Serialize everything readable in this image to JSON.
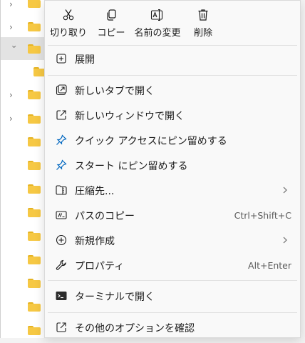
{
  "toolbar": {
    "cut_label": "切り取り",
    "copy_label": "コピー",
    "rename_label": "名前の変更",
    "delete_label": "削除"
  },
  "menu": {
    "expand": "展開",
    "open_new_tab": "新しいタブで開く",
    "open_new_window": "新しいウィンドウで開く",
    "pin_quick_access": "クイック アクセスにピン留めする",
    "pin_start": "スタート にピン留めする",
    "compress": "圧縮先...",
    "copy_path": "パスのコピー",
    "copy_path_shortcut": "Ctrl+Shift+C",
    "new": "新規作成",
    "properties": "プロパティ",
    "properties_shortcut": "Alt+Enter",
    "open_terminal": "ターミナルで開く",
    "more_options": "その他のオプションを確認"
  },
  "colors": {
    "accent": "#0067c0",
    "folder": "#f6c844",
    "menu_bg": "#f9f9f9"
  }
}
